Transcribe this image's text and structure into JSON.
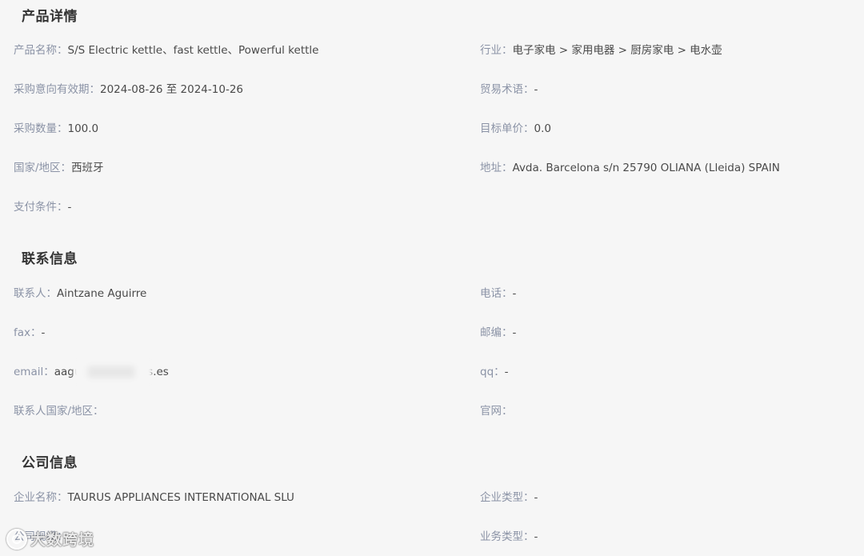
{
  "sections": {
    "product": {
      "title": "产品详情",
      "fields": [
        {
          "label": "产品名称：",
          "value": "S/S Electric kettle、fast kettle、Powerful kettle"
        },
        {
          "label": "行业：",
          "value": "电子家电 > 家用电器 > 厨房家电 > 电水壶"
        },
        {
          "label": "采购意向有效期：",
          "value": "2024-08-26 至 2024-10-26"
        },
        {
          "label": "贸易术语：",
          "value": "-"
        },
        {
          "label": "采购数量：",
          "value": "100.0"
        },
        {
          "label": "目标单价：",
          "value": "0.0"
        },
        {
          "label": "国家/地区：",
          "value": "西班牙"
        },
        {
          "label": "地址：",
          "value": "Avda. Barcelona s/n 25790 OLIANA (Lleida) SPAIN"
        },
        {
          "label": "支付条件：",
          "value": "-"
        }
      ]
    },
    "contact": {
      "title": "联系信息",
      "fields": [
        {
          "label": "联系人：",
          "value": "Aintzane Aguirre"
        },
        {
          "label": "电话：",
          "value": "-"
        },
        {
          "label": "fax：",
          "value": "-"
        },
        {
          "label": "邮编：",
          "value": "-"
        },
        {
          "label": "email：",
          "value": "aagu                rus.es"
        },
        {
          "label": "qq：",
          "value": "-"
        },
        {
          "label": "联系人国家/地区：",
          "value": ""
        },
        {
          "label": "官网：",
          "value": ""
        }
      ]
    },
    "company": {
      "title": "公司信息",
      "fields": [
        {
          "label": "企业名称：",
          "value": "TAURUS APPLIANCES INTERNATIONAL SLU"
        },
        {
          "label": "企业类型：",
          "value": "-"
        },
        {
          "label": "公司规模：",
          "value": ""
        },
        {
          "label": "业务类型：",
          "value": "-"
        }
      ]
    }
  },
  "watermark": {
    "text": "大数跨境"
  }
}
